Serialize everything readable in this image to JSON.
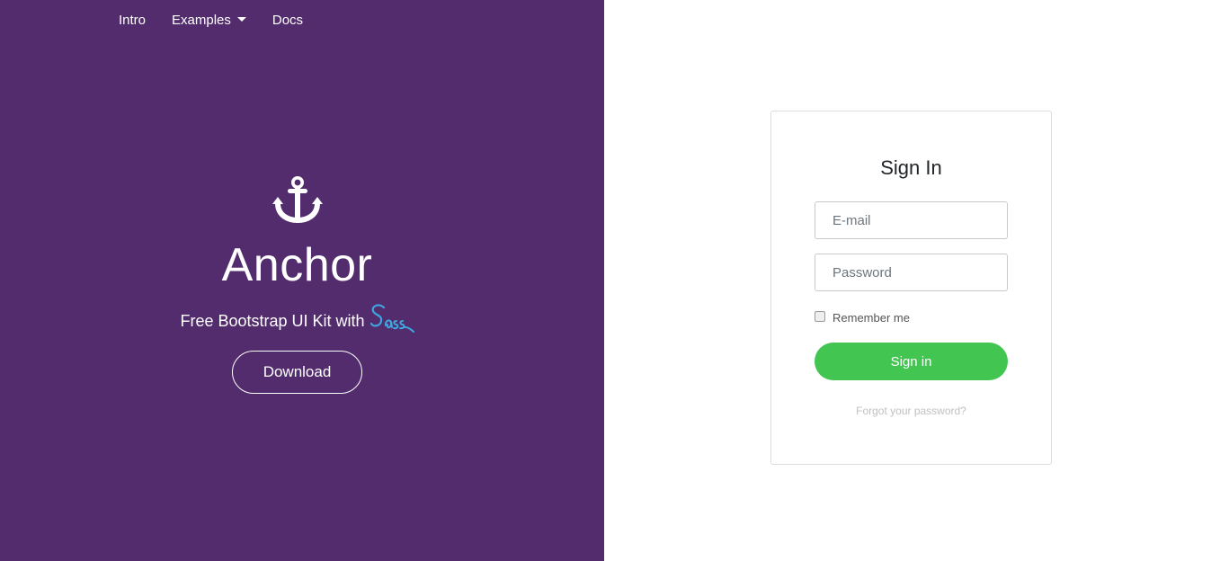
{
  "nav": {
    "items": [
      {
        "label": "Intro"
      },
      {
        "label": "Examples",
        "has_dropdown": true
      },
      {
        "label": "Docs"
      }
    ]
  },
  "hero": {
    "icon": "anchor-icon",
    "title": "Anchor",
    "subtitle": "Free Bootstrap UI Kit with",
    "subtitle_logo": "Sass",
    "download_label": "Download"
  },
  "signin": {
    "title": "Sign In",
    "email_placeholder": "E-mail",
    "password_placeholder": "Password",
    "remember_label": "Remember me",
    "remember_checked": false,
    "submit_label": "Sign in",
    "forgot_label": "Forgot your password?"
  },
  "colors": {
    "left_background": "#522c6c",
    "accent_green": "#43c552",
    "sass_blue": "#3fa6e0"
  }
}
